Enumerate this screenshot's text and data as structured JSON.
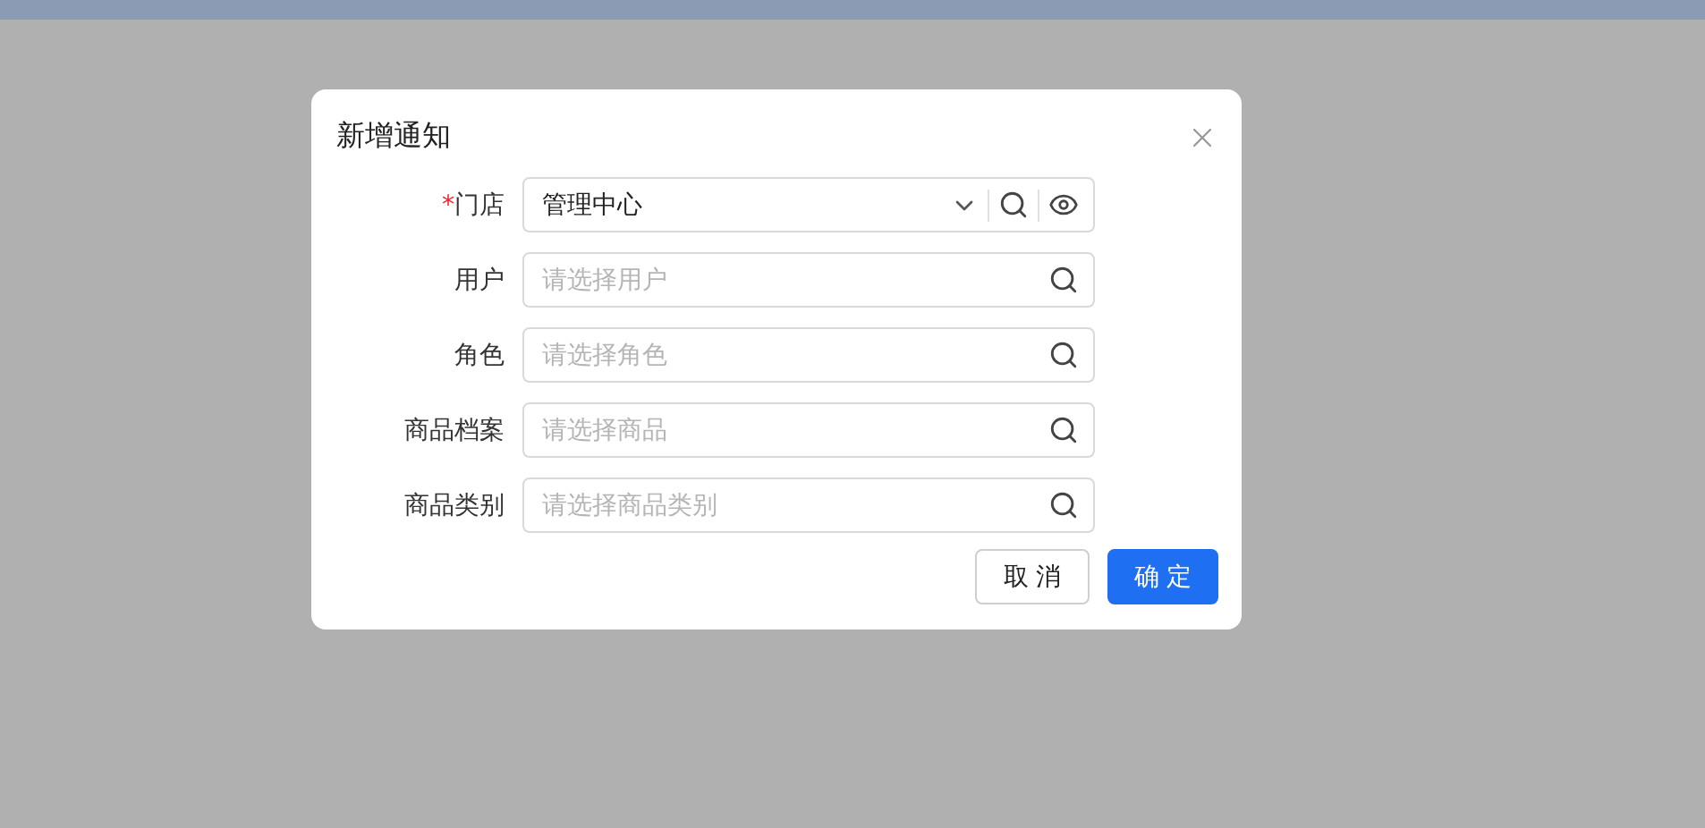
{
  "dialog": {
    "title": "新增通知",
    "required_mark": "*",
    "fields": [
      {
        "label": "门店",
        "required": true,
        "kind": "select",
        "value": "管理中心"
      },
      {
        "label": "用户",
        "required": false,
        "kind": "search",
        "placeholder": "请选择用户"
      },
      {
        "label": "角色",
        "required": false,
        "kind": "search",
        "placeholder": "请选择角色"
      },
      {
        "label": "商品档案",
        "required": false,
        "kind": "search",
        "placeholder": "请选择商品"
      },
      {
        "label": "商品类别",
        "required": false,
        "kind": "search",
        "placeholder": "请选择商品类别"
      }
    ],
    "buttons": [
      {
        "label": "取 消",
        "kind": "default"
      },
      {
        "label": "确 定",
        "kind": "primary"
      }
    ]
  }
}
